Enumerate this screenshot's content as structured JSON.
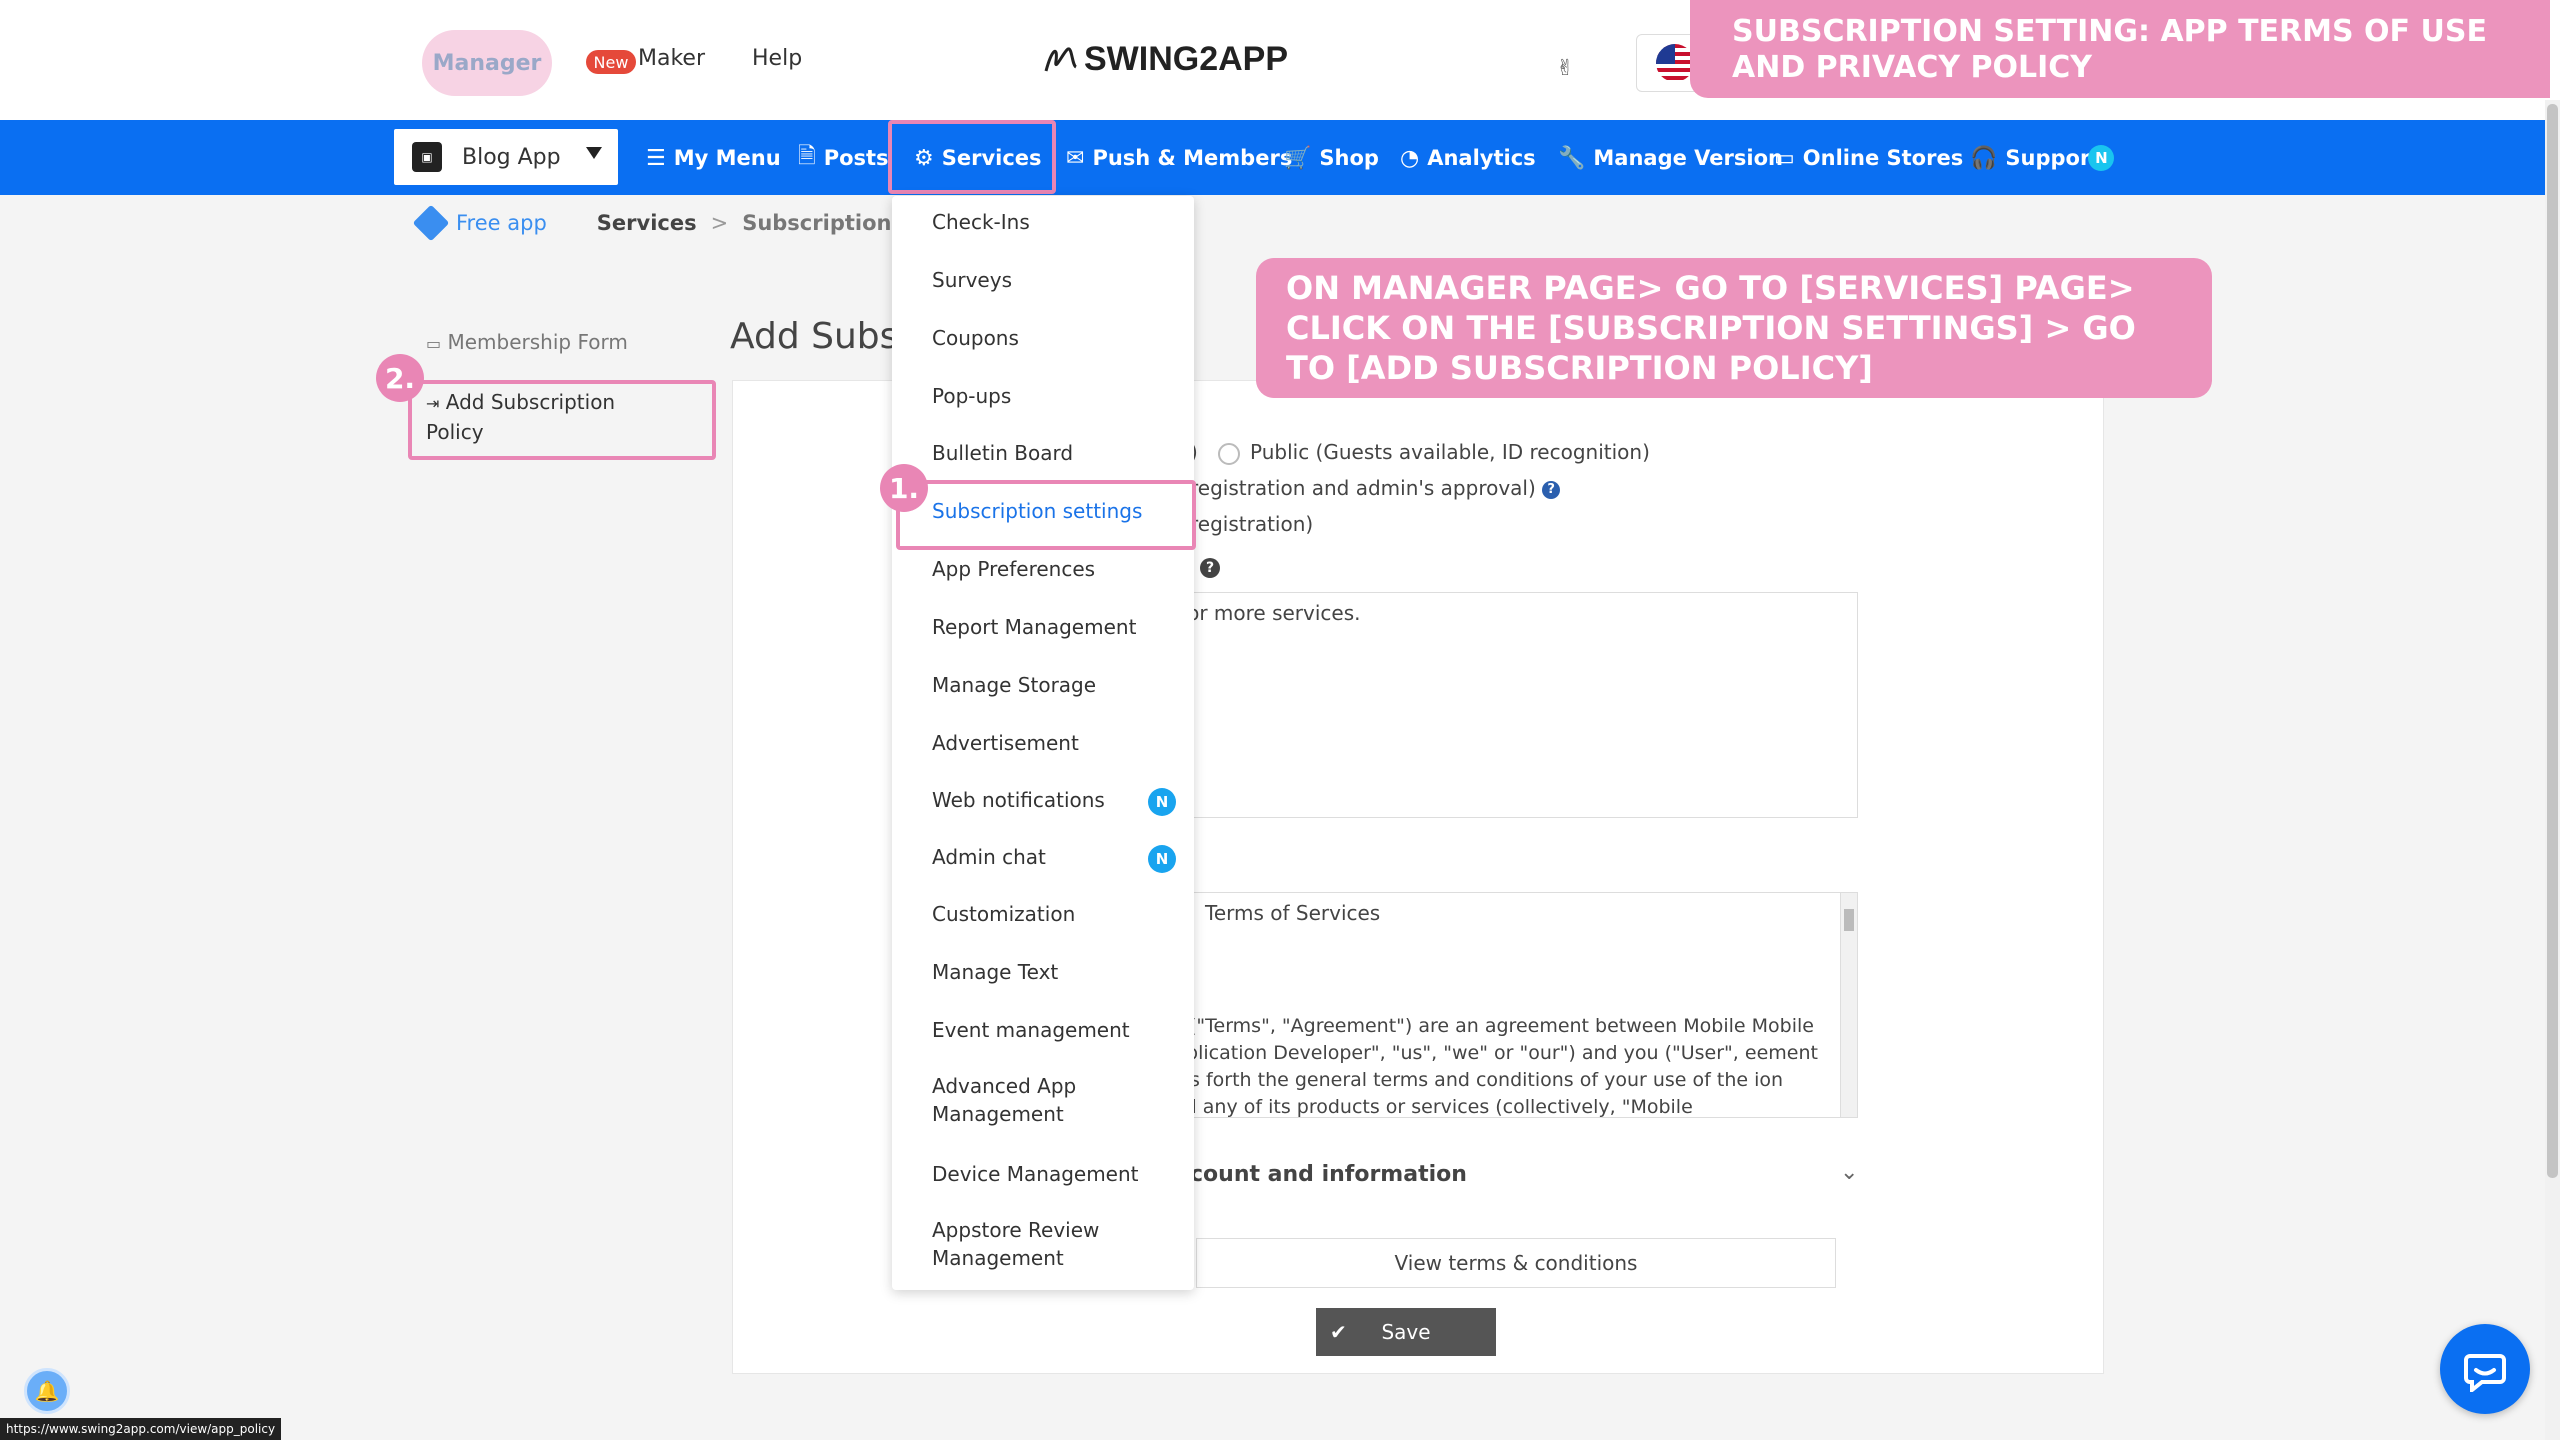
{
  "topbar": {
    "manager": "Manager",
    "new_badge": "New",
    "maker": "Maker",
    "help": "Help",
    "logo": "SWING2APP"
  },
  "banners": {
    "top": "SUBSCRIPTION SETTING: APP TERMS OF USE AND PRIVACY POLICY",
    "mid": "ON MANAGER PAGE> GO TO [SERVICES] PAGE> CLICK ON THE [SUBSCRIPTION SETTINGS] > GO TO [ADD SUBSCRIPTION POLICY]"
  },
  "nav": {
    "app_select": "Blog App",
    "items": [
      {
        "label": "My Menu",
        "icon": "menu-icon"
      },
      {
        "label": "Posts",
        "icon": "document-icon"
      },
      {
        "label": "Services",
        "icon": "gear-icon"
      },
      {
        "label": "Push & Members",
        "icon": "mail-icon"
      },
      {
        "label": "Shop",
        "icon": "cart-icon"
      },
      {
        "label": "Analytics",
        "icon": "pie-chart-icon"
      },
      {
        "label": "Manage Version",
        "icon": "wrench-icon"
      },
      {
        "label": "Online Stores",
        "icon": "card-icon"
      },
      {
        "label": "Suppor",
        "icon": "headset-icon",
        "badge": "N"
      }
    ]
  },
  "breadcrumb": {
    "free_app": "Free app",
    "services": "Services",
    "separator": ">",
    "current": "Subscription Settings"
  },
  "sidebar": {
    "items": [
      {
        "label": "Membership Form"
      },
      {
        "label": "Add Subscription Policy"
      }
    ]
  },
  "steps": {
    "one": "1.",
    "two": "2."
  },
  "main": {
    "title": "Add Subsc",
    "radio_close": ")",
    "radio_public": "Public (Guests available, ID recognition)",
    "line_registration_approval": "registration and admin's approval)",
    "line_registration": "registration)",
    "textarea1_text": "p for more services.",
    "tos_title": "Terms of Services",
    "tos_body": "ns (\"Terms\", \"Agreement\") are an agreement between Mobile Mobile Application Developer\", \"us\", \"we\" or \"our\") and you (\"User\", eement sets forth the general terms and conditions of your use of the ion and any of its products or services (collectively, \"Mobile",
    "account_heading": "count and information",
    "view_terms": "View terms & conditions",
    "save": "Save"
  },
  "dropdown": {
    "items": [
      {
        "label": "Check-Ins"
      },
      {
        "label": "Surveys"
      },
      {
        "label": "Coupons"
      },
      {
        "label": "Pop-ups"
      },
      {
        "label": "Bulletin Board"
      },
      {
        "label": "Subscription settings",
        "active": true
      },
      {
        "label": "App Preferences"
      },
      {
        "label": "Report Management"
      },
      {
        "label": "Manage Storage"
      },
      {
        "label": "Advertisement"
      },
      {
        "label": "Web notifications",
        "badge": "N"
      },
      {
        "label": "Admin chat",
        "badge": "N"
      },
      {
        "label": "Customization"
      },
      {
        "label": "Manage Text"
      },
      {
        "label": "Event management"
      },
      {
        "label": "Advanced App Management"
      },
      {
        "label": "Device Management"
      },
      {
        "label": "Appstore Review Management"
      }
    ]
  },
  "status_url": "https://www.swing2app.com/view/app_policy",
  "colors": {
    "nav_blue": "#0a6ff2",
    "highlight_pink": "#e986b5",
    "banner_pink": "#ec94bd",
    "active_link": "#1a73e8"
  }
}
